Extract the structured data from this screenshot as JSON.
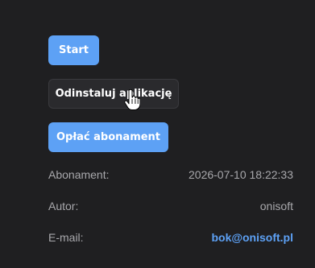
{
  "buttons": {
    "start_label": "Start",
    "uninstall_label": "Odinstaluj aplikację",
    "pay_label": "Opłać abonament"
  },
  "info": {
    "subscription_label": "Abonament:",
    "subscription_value": "2026-07-10 18:22:33",
    "author_label": "Autor:",
    "author_value": "onisoft",
    "email_label": "E-mail:",
    "email_value": "bok@onisoft.pl"
  },
  "colors": {
    "background": "#1f1f21",
    "accent": "#5da1f5",
    "muted_text": "#a8a8ac"
  },
  "icons": {
    "cursor": "hand-pointer-icon"
  }
}
